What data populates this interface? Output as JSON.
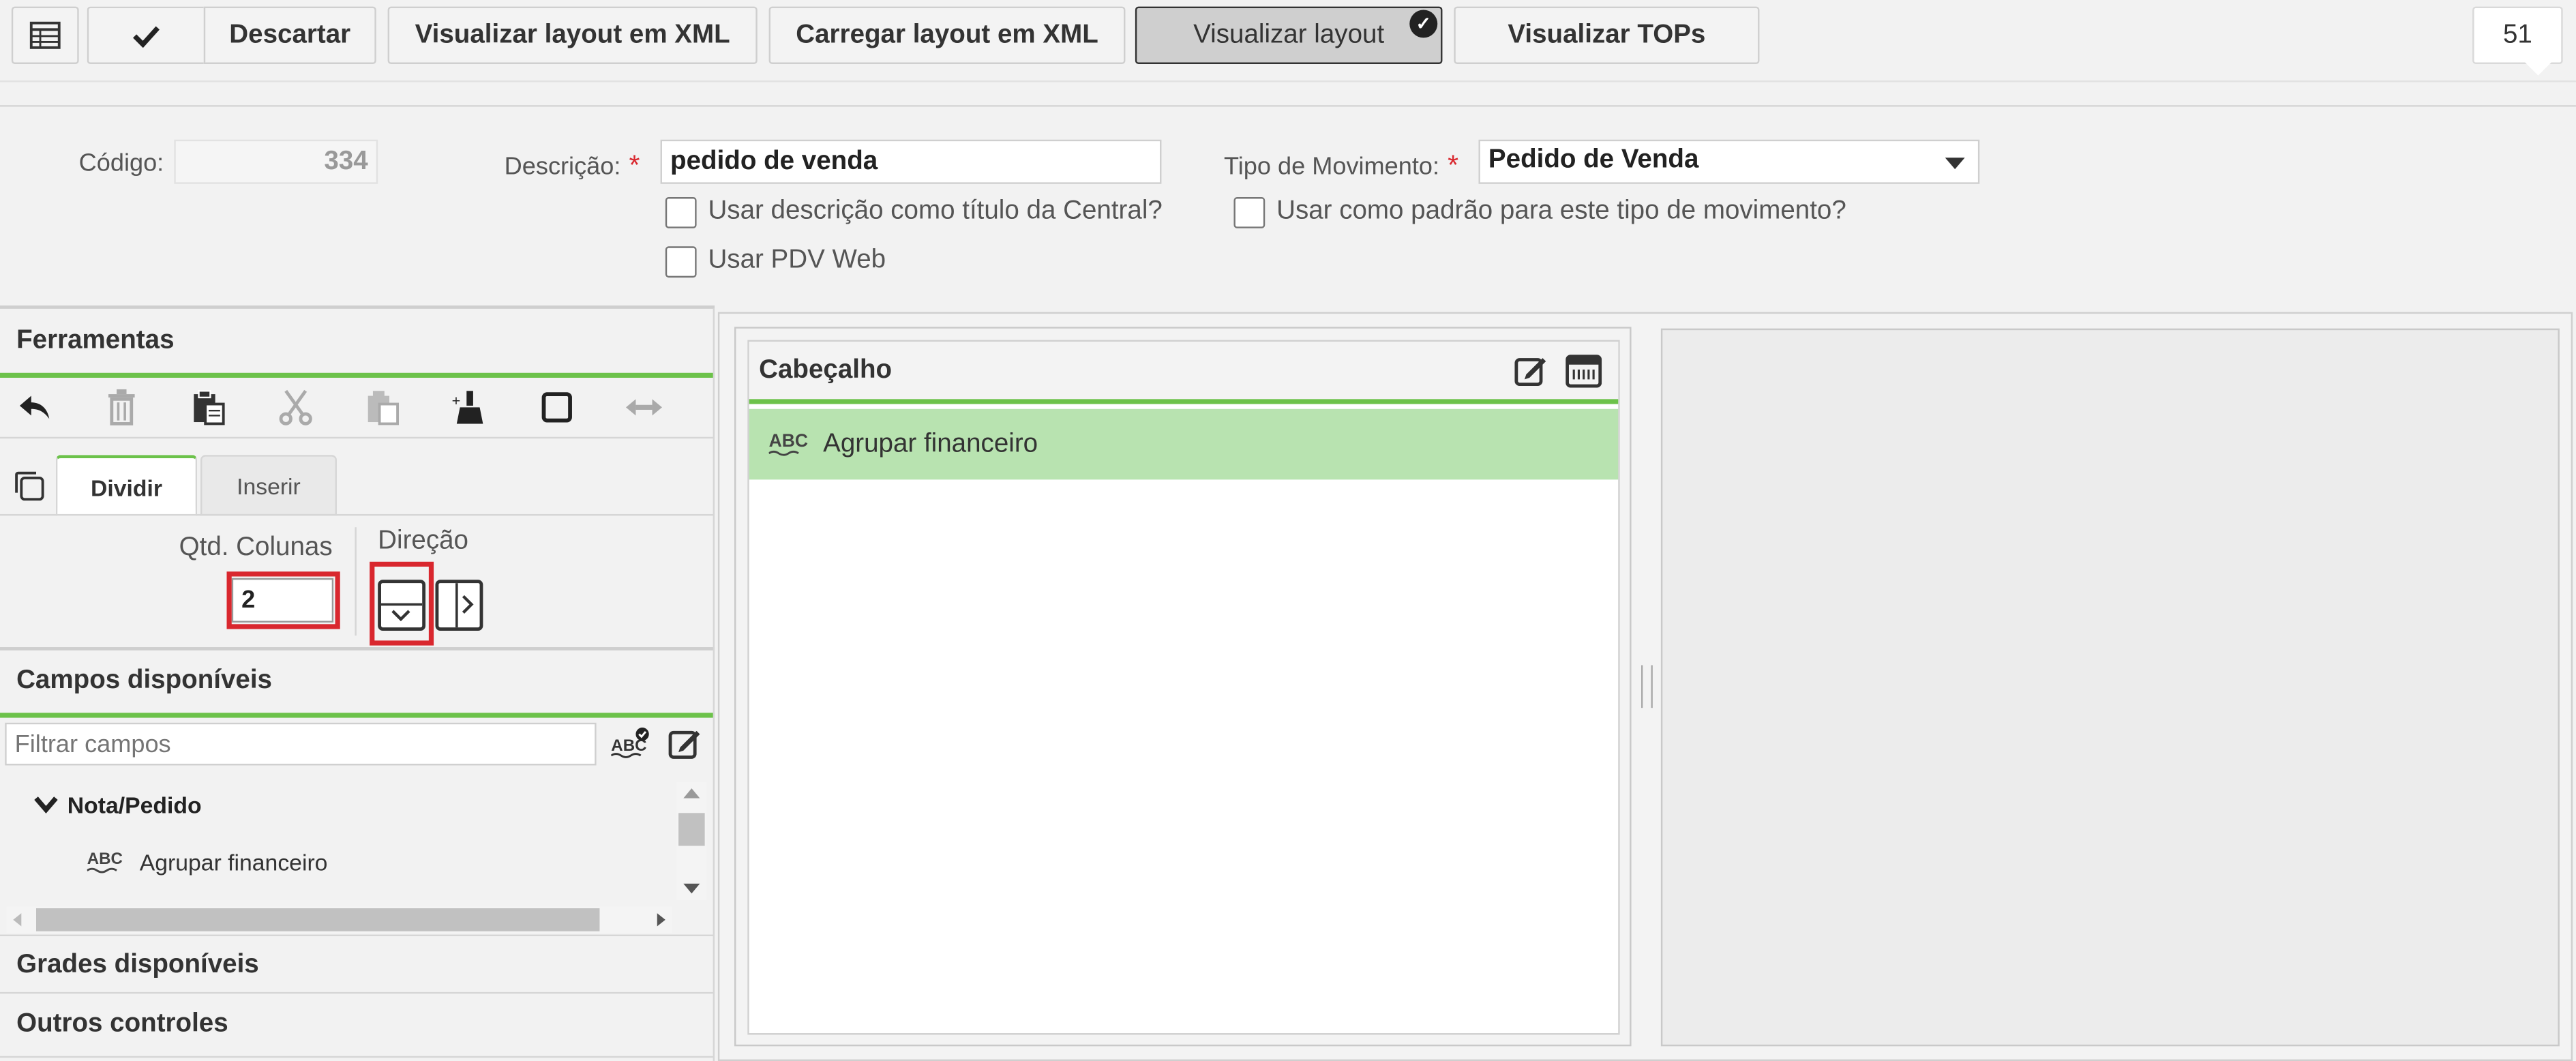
{
  "toolbar": {
    "discard_label": "Descartar",
    "view_xml_label": "Visualizar layout em XML",
    "load_xml_label": "Carregar layout em XML",
    "view_layout_label": "Visualizar layout",
    "view_tops_label": "Visualizar TOPs",
    "counter": "51"
  },
  "form": {
    "codigo_label": "Código:",
    "codigo_value": "334",
    "descricao_label": "Descrição:",
    "descricao_value": "pedido de venda",
    "tipo_label": "Tipo de Movimento:",
    "tipo_value": "Pedido de Venda",
    "required_mark": "*",
    "chk_titulo_label": "Usar descrição como título da Central?",
    "chk_padrao_label": "Usar como padrão para este tipo de movimento?",
    "chk_pdv_label": "Usar PDV Web"
  },
  "left": {
    "ferramentas_title": "Ferramentas",
    "tabs": [
      {
        "label": "Dividir"
      },
      {
        "label": "Inserir"
      }
    ],
    "qtd_colunas_label": "Qtd. Colunas",
    "qtd_colunas_value": "2",
    "direcao_label": "Direção",
    "campos_title": "Campos disponíveis",
    "filter_placeholder": "Filtrar campos",
    "tree_group": "Nota/Pedido",
    "tree_item": "Agrupar financeiro",
    "grades_title": "Grades disponíveis",
    "outros_title": "Outros controles"
  },
  "canvas": {
    "card_title": "Cabeçalho",
    "card_field": "Agrupar financeiro"
  },
  "colors": {
    "accent_green": "#6cc24a",
    "row_green": "#b8e3b0",
    "required_red": "#d9272e",
    "highlight_red": "#d9272e"
  }
}
